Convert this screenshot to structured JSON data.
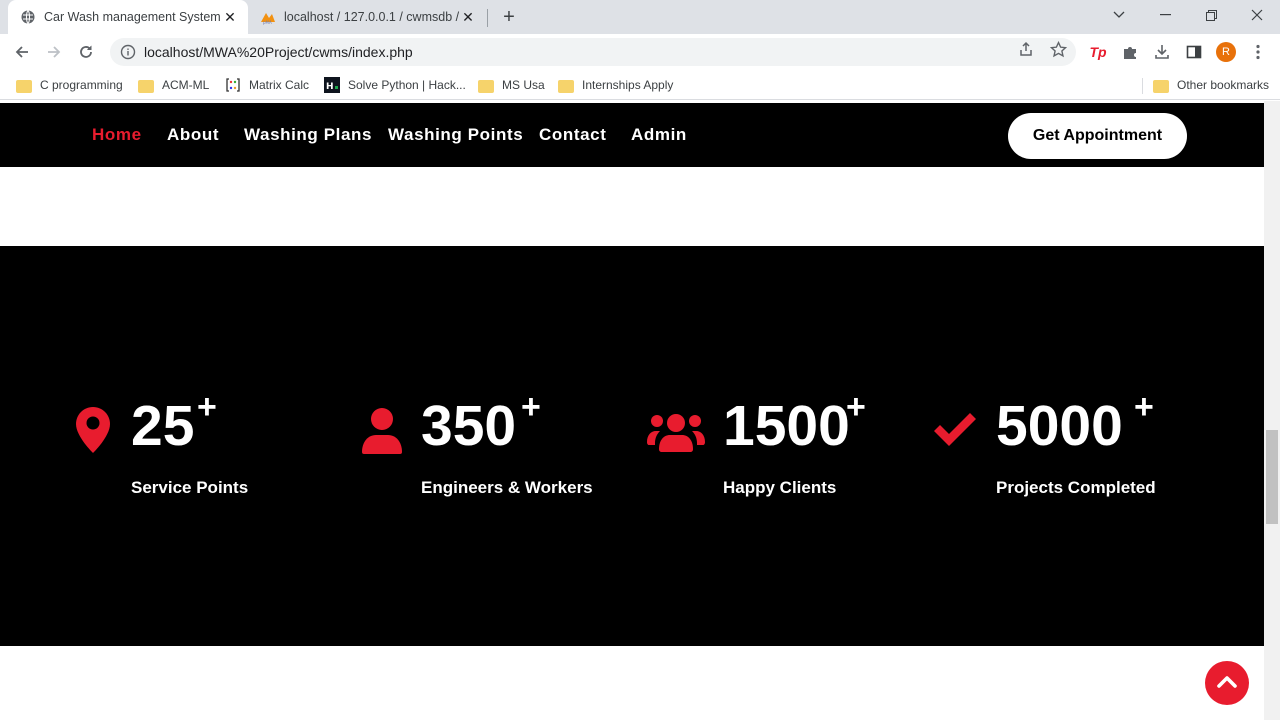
{
  "browser": {
    "tabs": [
      {
        "title": "Car Wash management System |",
        "active": true
      },
      {
        "title": "localhost / 127.0.0.1 / cwmsdb / t",
        "active": false
      }
    ],
    "url": "localhost/MWA%20Project/cwms/index.php",
    "profile_initial": "R",
    "bookmarks": [
      "C programming",
      "ACM-ML",
      "Matrix Calc",
      "Solve Python | Hack...",
      "MS Usa",
      "Internships Apply"
    ],
    "other_bookmarks": "Other bookmarks"
  },
  "nav": {
    "links": [
      "Home",
      "About",
      "Washing Plans",
      "Washing Points",
      "Contact",
      "Admin"
    ],
    "active": "Home",
    "cta": "Get Appointment"
  },
  "stats": [
    {
      "icon": "map-pin-icon",
      "number": "25",
      "suffix": "+",
      "label": "Service Points"
    },
    {
      "icon": "user-icon",
      "number": "350",
      "suffix": "+",
      "label": "Engineers & Workers"
    },
    {
      "icon": "users-icon",
      "number": "1500",
      "suffix": "+",
      "label": "Happy Clients"
    },
    {
      "icon": "check-icon",
      "number": "5000",
      "suffix": "+",
      "label": "Projects Completed"
    }
  ],
  "colors": {
    "accent": "#e81c2e",
    "dark": "#000000",
    "text_light": "#ffffff"
  }
}
